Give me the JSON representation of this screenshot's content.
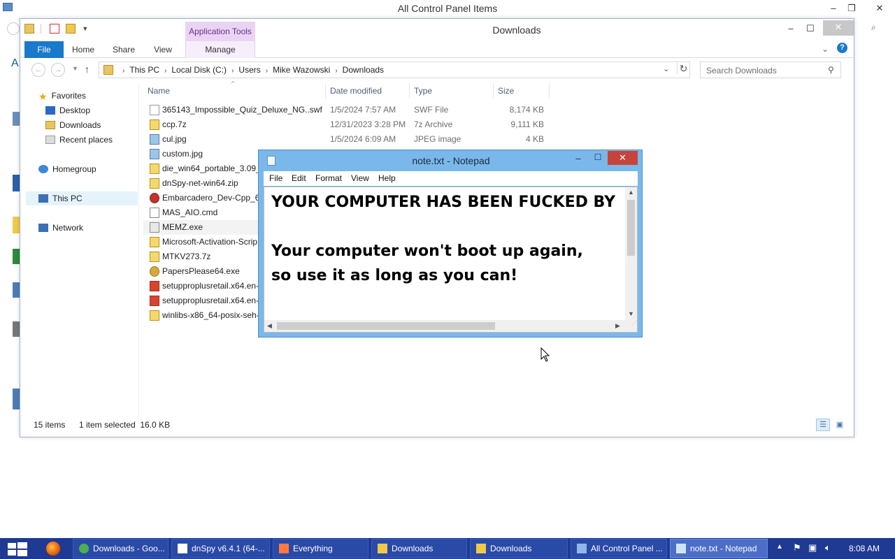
{
  "background_window": {
    "title": "All Control Panel Items"
  },
  "explorer": {
    "title": "Downloads",
    "context_tab_group": "Application Tools",
    "tabs": [
      "File",
      "Home",
      "Share",
      "View",
      "Manage"
    ],
    "breadcrumb": [
      "This PC",
      "Local Disk (C:)",
      "Users",
      "Mike Wazowski",
      "Downloads"
    ],
    "search_placeholder": "Search Downloads",
    "nav_pane": {
      "favorites": "Favorites",
      "desktop": "Desktop",
      "downloads": "Downloads",
      "recent": "Recent places",
      "homegroup": "Homegroup",
      "this_pc": "This PC",
      "network": "Network"
    },
    "columns": {
      "name": "Name",
      "date": "Date modified",
      "type": "Type",
      "size": "Size"
    },
    "files": [
      {
        "name": "365143_Impossible_Quiz_Deluxe_NG..swf",
        "date": "1/5/2024 7:57 AM",
        "type": "SWF File",
        "size": "8,174 KB",
        "icon": "file"
      },
      {
        "name": "ccp.7z",
        "date": "12/31/2023 3:28 PM",
        "type": "7z Archive",
        "size": "9,111 KB",
        "icon": "zip"
      },
      {
        "name": "cul.jpg",
        "date": "1/5/2024 6:09 AM",
        "type": "JPEG image",
        "size": "4 KB",
        "icon": "img"
      },
      {
        "name": "custom.jpg",
        "date": "",
        "type": "",
        "size": "",
        "icon": "img"
      },
      {
        "name": "die_win64_portable_3.09_x",
        "date": "",
        "type": "",
        "size": "",
        "icon": "zip"
      },
      {
        "name": "dnSpy-net-win64.zip",
        "date": "",
        "type": "",
        "size": "",
        "icon": "zip"
      },
      {
        "name": "Embarcadero_Dev-Cpp_6.",
        "date": "",
        "type": "",
        "size": "",
        "icon": "red"
      },
      {
        "name": "MAS_AIO.cmd",
        "date": "",
        "type": "",
        "size": "",
        "icon": "cmd"
      },
      {
        "name": "MEMZ.exe",
        "date": "",
        "type": "",
        "size": "",
        "icon": "exe",
        "selected": true
      },
      {
        "name": "Microsoft-Activation-Scrip",
        "date": "",
        "type": "",
        "size": "",
        "icon": "zip"
      },
      {
        "name": "MTKV273.7z",
        "date": "",
        "type": "",
        "size": "",
        "icon": "zip"
      },
      {
        "name": "PapersPlease64.exe",
        "date": "",
        "type": "",
        "size": "",
        "icon": "pp"
      },
      {
        "name": "setupproplusretail.x64.en-",
        "date": "",
        "type": "",
        "size": "",
        "icon": "ofc"
      },
      {
        "name": "setupproplusretail.x64.en-",
        "date": "",
        "type": "",
        "size": "",
        "icon": "ofc"
      },
      {
        "name": "winlibs-x86_64-posix-seh-",
        "date": "",
        "type": "",
        "size": "",
        "icon": "zip"
      }
    ],
    "status": {
      "count": "15 items",
      "selected": "1 item selected  16.0 KB"
    }
  },
  "notepad": {
    "title": "note.txt - Notepad",
    "menu": [
      "File",
      "Edit",
      "Format",
      "View",
      "Help"
    ],
    "content": "YOUR COMPUTER HAS BEEN FUCKED BY\n\nYour computer won't boot up again,\nso use it as long as you can!"
  },
  "taskbar": {
    "apps": [
      {
        "label": "Downloads - Goo...",
        "icon": "chrome-icon"
      },
      {
        "label": "dnSpy v6.4.1 (64-...",
        "icon": "dnspy-icon"
      },
      {
        "label": "Everything",
        "icon": "search-icon"
      },
      {
        "label": "Downloads",
        "icon": "folder-icon"
      },
      {
        "label": "Downloads",
        "icon": "folder-icon"
      },
      {
        "label": "All Control Panel ...",
        "icon": "control-panel-icon"
      },
      {
        "label": "note.txt - Notepad",
        "icon": "notepad-icon",
        "active": true
      }
    ],
    "clock": "8:08 AM"
  },
  "colors": {
    "taskbar": "#1f3a93",
    "file_tab": "#1979ca",
    "notepad_frame": "#7ab8ec",
    "close_red": "#c7443a"
  }
}
